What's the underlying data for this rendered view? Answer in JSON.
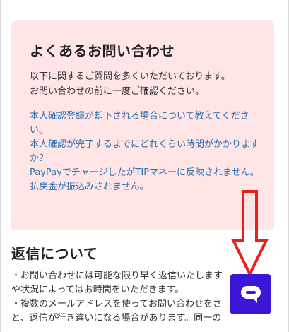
{
  "faq": {
    "title": "よくあるお問い合わせ",
    "intro": [
      "以下に関するご質問を多くいただいております。",
      "お問い合わせの前に一度ご確認ください。"
    ],
    "links": [
      "本人確認登録が却下される場合について教えてください。",
      "本人確認が完了するまでにどれくらい時間がかかりますか？",
      "PayPayでチャージしたがTIPマネーに反映されません。",
      "払戻金が振込みされません。"
    ]
  },
  "reply": {
    "heading": "返信について",
    "lines": [
      "・お問い合わせには可能な限り早く返信いたします",
      "や状況によってはお時間をいただきます。",
      "・複数のメールアドレスを使ってお問い合わせをさ",
      "と、返信が行き違いになる場合があります。同一の"
    ]
  },
  "annotation": {
    "arrow_color": "#e8211f"
  },
  "chat": {
    "icon": "chat-bubble-icon",
    "button_color": "#3b16d6"
  }
}
